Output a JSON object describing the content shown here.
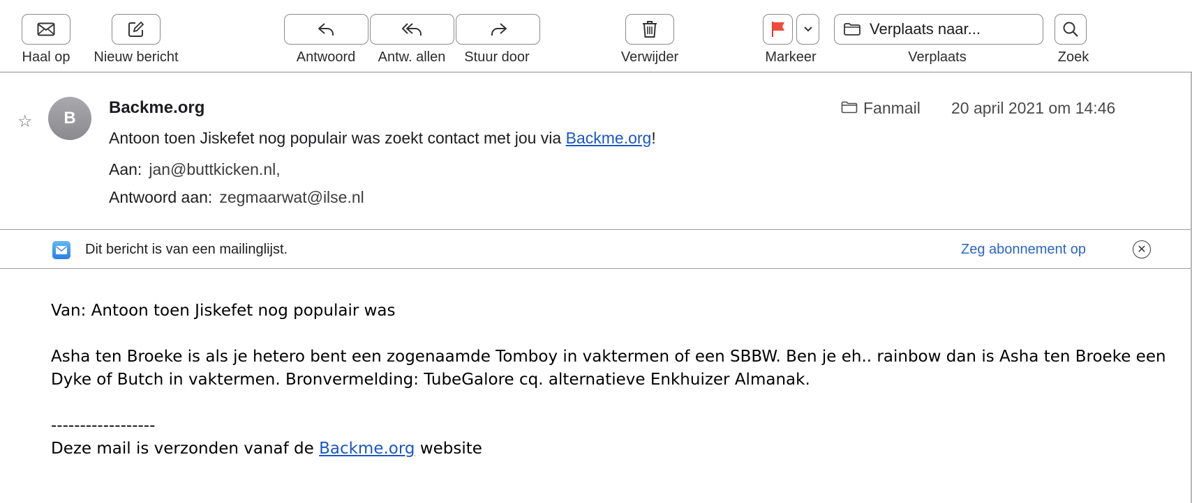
{
  "toolbar": {
    "get_mail": "Haal op",
    "new_message": "Nieuw bericht",
    "reply": "Antwoord",
    "reply_all": "Antw. allen",
    "forward": "Stuur door",
    "delete": "Verwijder",
    "flag": "Markeer",
    "move_field": "Verplaats naar...",
    "move": "Verplaats",
    "search": "Zoek",
    "flag_color": "#f04b3a"
  },
  "message": {
    "sender": "Backme.org",
    "avatar_initial": "B",
    "subject_text": "Antoon toen Jiskefet nog populair was zoekt contact met jou via ",
    "subject_link": "Backme.org",
    "subject_end": "!",
    "to_label": "Aan:",
    "to_value": "jan@buttkicken.nl,",
    "reply_to_label": "Antwoord aan:",
    "reply_to_value": "zegmaarwat@ilse.nl",
    "folder": "Fanmail",
    "date": "20 april 2021 om 14:46"
  },
  "banner": {
    "text": "Dit bericht is van een mailinglijst.",
    "unsubscribe": "Zeg abonnement op"
  },
  "body": {
    "from_line": "Van: Antoon toen Jiskefet nog populair was",
    "paragraph": "Asha ten Broeke is als je hetero bent een zogenaamde Tomboy in vaktermen of een SBBW. Ben je eh.. rainbow dan is Asha ten Broeke een Dyke of Butch in vaktermen. Bronvermelding: TubeGalore cq. alternatieve Enkhuizer Almanak.",
    "separator": "------------------",
    "footer_text": "Deze mail is verzonden vanaf de ",
    "footer_link": "Backme.org",
    "footer_end": " website"
  }
}
